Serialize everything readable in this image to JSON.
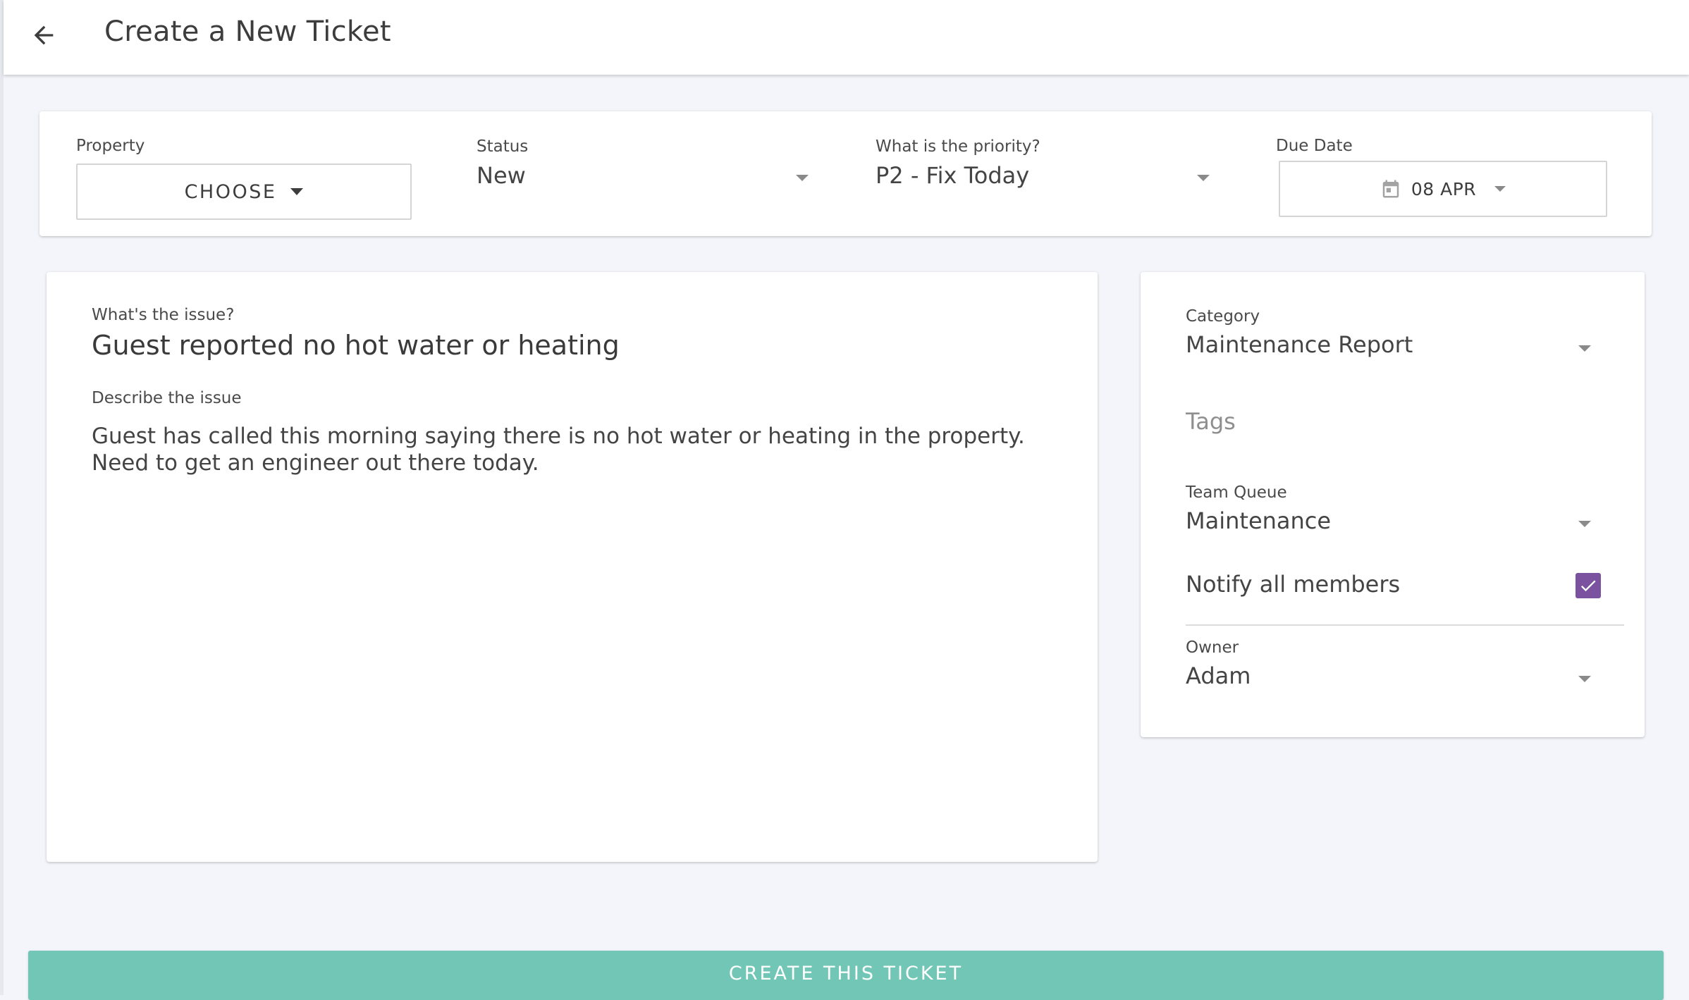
{
  "header": {
    "title": "Create a New Ticket",
    "back_icon": "arrow-left-icon"
  },
  "top_fields": {
    "property": {
      "label": "Property",
      "button_text": "CHOOSE"
    },
    "status": {
      "label": "Status",
      "value": "New"
    },
    "priority": {
      "label": "What is the priority?",
      "value": "P2 - Fix Today"
    },
    "due_date": {
      "label": "Due Date",
      "value": "08 APR",
      "icon": "calendar-icon"
    }
  },
  "issue": {
    "title_label": "What's the issue?",
    "title_value": "Guest reported no hot water or heating",
    "description_label": "Describe the issue",
    "description_value": "Guest has called this morning saying there is no hot water or heating in the property.  Need to get an engineer out there today."
  },
  "side": {
    "category": {
      "label": "Category",
      "value": "Maintenance Report"
    },
    "tags": {
      "placeholder": "Tags"
    },
    "team_queue": {
      "label": "Team Queue",
      "value": "Maintenance"
    },
    "notify": {
      "label": "Notify all members",
      "checked": true,
      "checked_color": "#7b52a0"
    },
    "owner": {
      "label": "Owner",
      "value": "Adam"
    }
  },
  "actions": {
    "create_label": "CREATE THIS TICKET",
    "create_color": "#72c6b6"
  }
}
